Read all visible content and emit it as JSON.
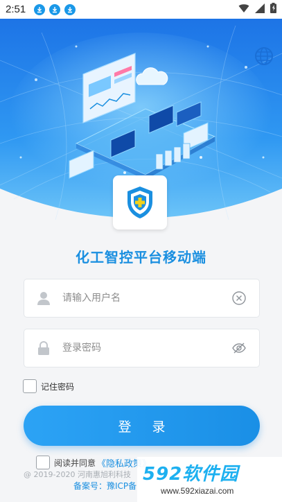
{
  "status_bar": {
    "time": "2:51"
  },
  "app": {
    "title": "化工智控平台移动端"
  },
  "login": {
    "username_placeholder": "请输入用户名",
    "password_placeholder": "登录密码",
    "remember_label": "记住密码",
    "submit_label": "登 录"
  },
  "agreement": {
    "prefix": "阅读并同意",
    "link": "《隐私政策》"
  },
  "footer": {
    "copyright": "@ 2019-2020 河南惠旭利科技",
    "icp": "备案号：豫ICP备"
  },
  "watermark": {
    "brand": "592软件园",
    "url": "www.592xiazai.com"
  },
  "colors": {
    "accent": "#1a8fe0",
    "hero_top": "#1d74e6",
    "hero_bottom": "#4fb1f5",
    "badge_yellow": "#f2d11a"
  },
  "icons": [
    "download-icon",
    "wifi-icon",
    "signal-icon",
    "battery-icon",
    "globe-icon",
    "shield-plus-icon",
    "user-icon",
    "clear-icon",
    "lock-icon",
    "eye-off-icon"
  ]
}
